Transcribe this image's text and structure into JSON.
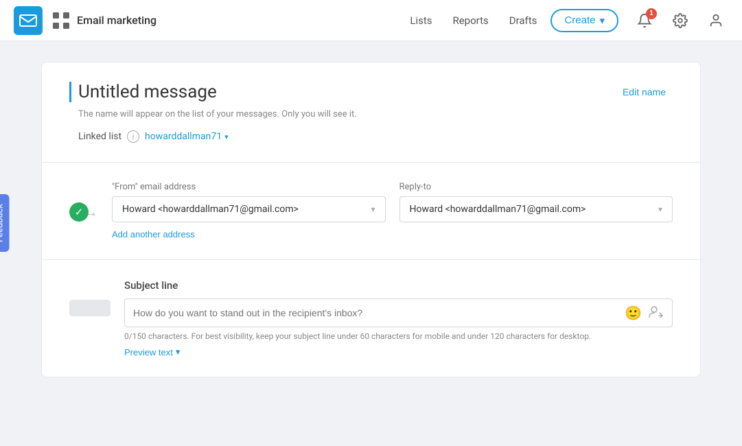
{
  "nav": {
    "logo_alt": "Email marketing logo",
    "brand": "Email marketing",
    "links": [
      {
        "label": "Lists",
        "key": "lists"
      },
      {
        "label": "Reports",
        "key": "reports"
      },
      {
        "label": "Drafts",
        "key": "drafts"
      }
    ],
    "create_label": "Create",
    "notification_count": "1"
  },
  "feedback": {
    "label": "Feedback"
  },
  "title_section": {
    "message_title": "Untitled message",
    "edit_name_label": "Edit name",
    "description": "The name will appear on the list of your messages. Only you will see it.",
    "linked_list_label": "Linked list",
    "linked_list_value": "howarddallman71"
  },
  "from_section": {
    "from_label": "\"From\" email address",
    "from_value": "Howard <howarddallman71@gmail.com>",
    "reply_to_label": "Reply-to",
    "reply_to_value": "Howard <howarddallman71@gmail.com>",
    "add_address_label": "Add another address"
  },
  "subject_section": {
    "subject_label": "Subject line",
    "subject_placeholder": "How do you want to stand out in the recipient's inbox?",
    "subject_hint": "0/150 characters. For best visibility, keep your subject line under 60 characters for mobile and under 120 characters for desktop.",
    "preview_text_label": "Preview text"
  }
}
